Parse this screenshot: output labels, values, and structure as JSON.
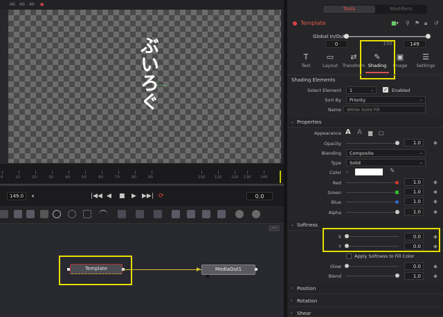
{
  "viewer": {
    "top_buttons": [
      "Ab",
      "Ab",
      "Ab",
      "●"
    ],
    "overlay_text": "ぶいろぐ",
    "ruler_ticks": [
      "0",
      "10",
      "20",
      "30",
      "40",
      "50",
      "60",
      "70",
      "80",
      "90",
      "100",
      "110",
      "120",
      "130",
      "140"
    ],
    "current_frame": "149.0",
    "time_out": "0.0"
  },
  "transport": {
    "audio_icon": "speaker-icon",
    "buttons": [
      "|◀◀",
      "◀",
      "■",
      "▶",
      "▶▶|"
    ],
    "loop_icon": "loop-icon"
  },
  "node_toolbar": {
    "icons": [
      "background-icon",
      "paint-icon",
      "text-icon",
      "merge-icon",
      "ellipse-icon",
      "polygon-icon",
      "bspline-icon",
      "bitmap-icon",
      "particles-icon",
      "3d-icon",
      "camera-icon",
      "light-icon",
      "renderer-icon",
      "shape-icon",
      "shape3d-icon",
      "sphere-icon",
      "globe-icon"
    ]
  },
  "node_editor": {
    "menu_label": "...",
    "nodes": [
      {
        "label": "Template"
      },
      {
        "label": "MediaOut1"
      }
    ]
  },
  "inspector": {
    "tabs_top": {
      "tools": "Tools",
      "modifiers": "Modifiers"
    },
    "tool_name": "Template",
    "global_io": {
      "label": "Global In/Out",
      "start": "0",
      "mid": "150",
      "end": "149"
    },
    "tabs": [
      {
        "label": "Text",
        "icon": "T"
      },
      {
        "label": "Layout",
        "icon": "▭"
      },
      {
        "label": "Transform",
        "icon": "⇄"
      },
      {
        "label": "Shading",
        "icon": "✎"
      },
      {
        "label": "Image",
        "icon": "▣"
      },
      {
        "label": "Settings",
        "icon": "☰"
      }
    ],
    "shading_elements": {
      "title": "Shading Elements",
      "select_element_label": "Select Element",
      "select_element_value": "1",
      "enabled_label": "Enabled",
      "sort_by_label": "Sort By",
      "sort_by_value": "Priority",
      "name_label": "Name",
      "name_placeholder": "White Solid Fill"
    },
    "properties": {
      "title": "Properties",
      "appearance_label": "Appearance",
      "opacity_label": "Opacity",
      "opacity_value": "1.0",
      "blending_label": "Blending",
      "blending_value": "Composite",
      "type_label": "Type",
      "type_value": "Solid",
      "color_label": "Color",
      "red_label": "Red",
      "red_value": "1.0",
      "green_label": "Green",
      "green_value": "1.0",
      "blue_label": "Blue",
      "blue_value": "1.0",
      "alpha_label": "Alpha",
      "alpha_value": "1.0"
    },
    "softness": {
      "title": "Softness",
      "x_label": "X",
      "x_value": "0.0",
      "y_label": "Y",
      "y_value": "0.0",
      "apply_label": "Apply Softness to Fill Color",
      "glow_label": "Glow",
      "glow_value": "0.0",
      "blend_label": "Blend",
      "blend_value": "1.0"
    },
    "collapsed_sections": [
      "Position",
      "Rotation",
      "Shear"
    ]
  },
  "colors": {
    "accent": "#e05050",
    "highlight": "#e8e000",
    "connector": "#d4c430"
  }
}
